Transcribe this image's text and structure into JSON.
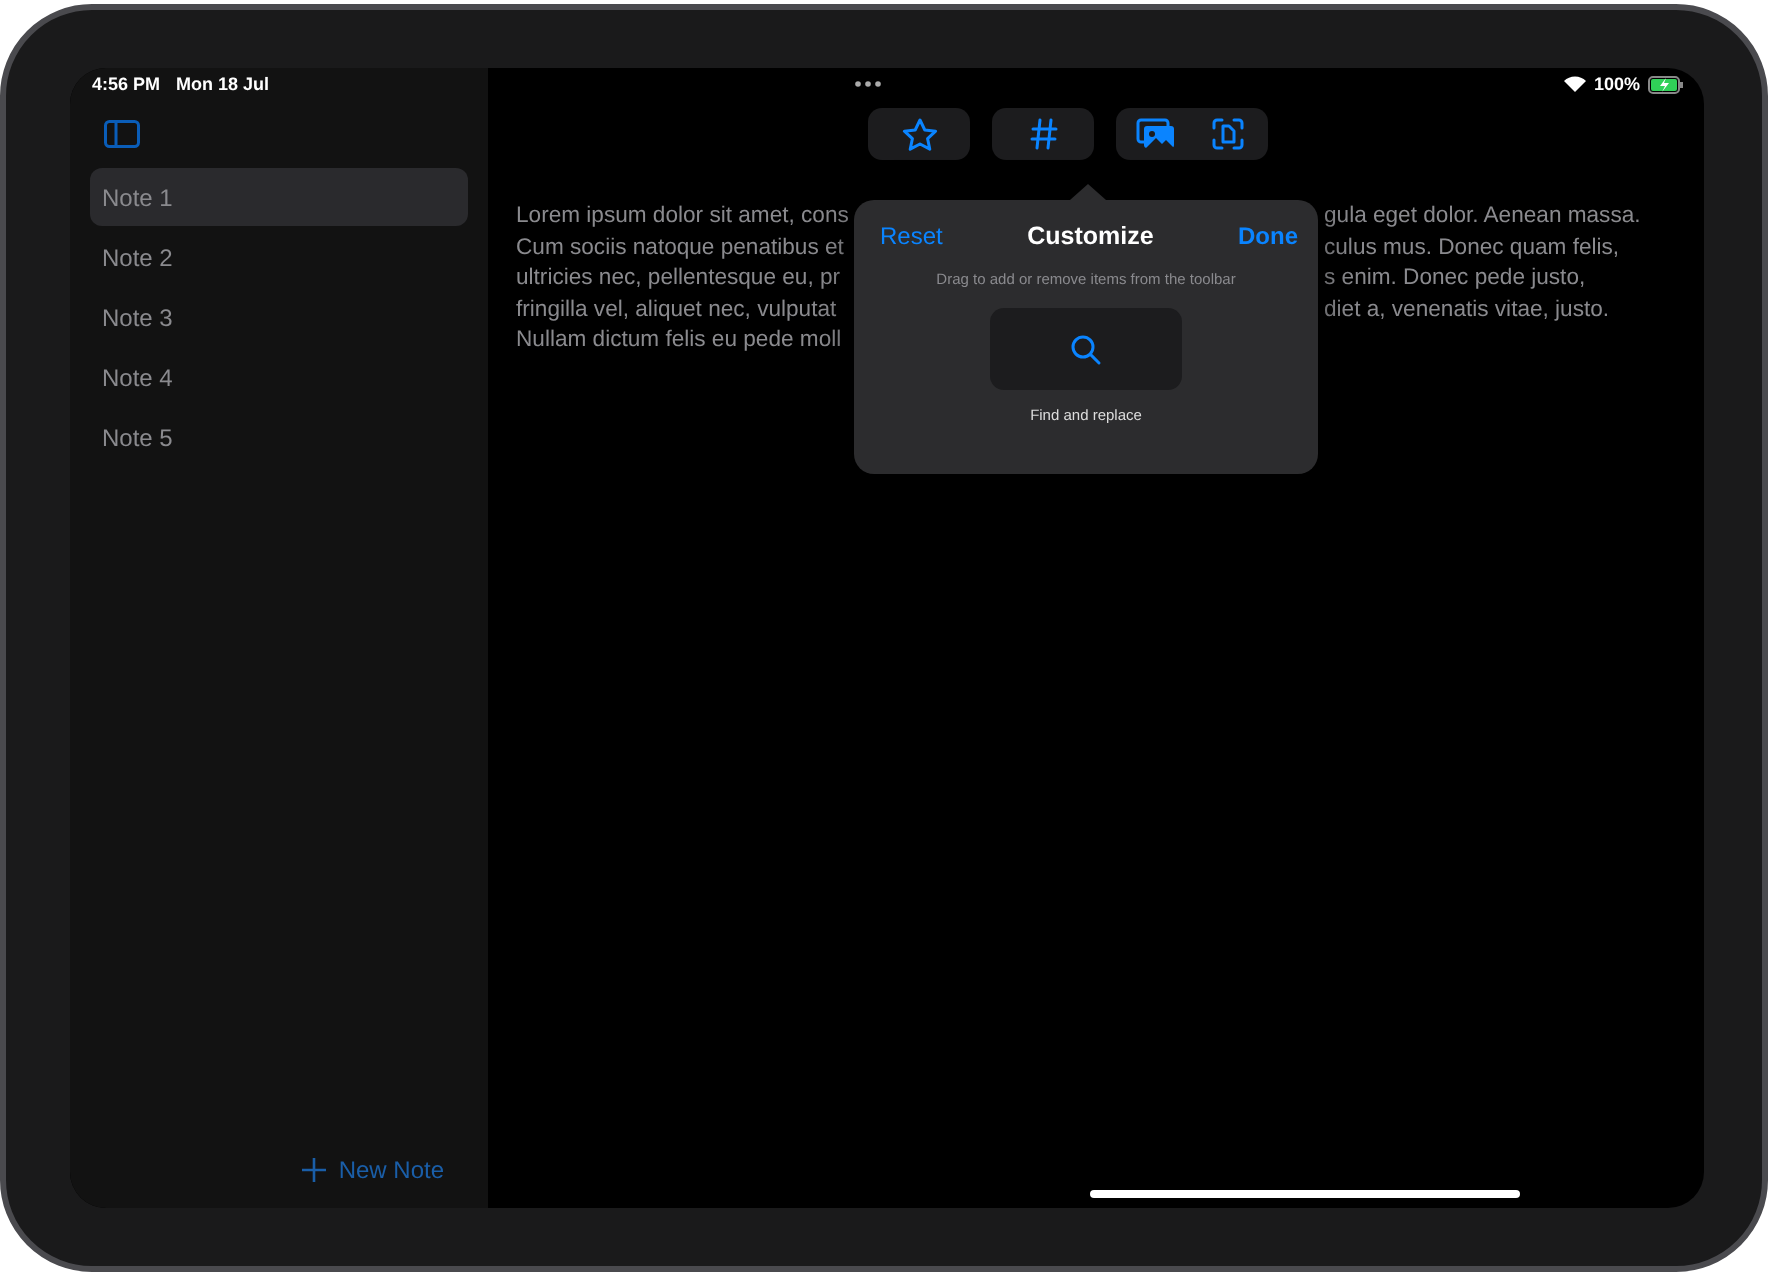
{
  "status_bar": {
    "time": "4:56 PM",
    "date": "Mon 18 Jul",
    "battery": "100%",
    "charging": true
  },
  "sidebar": {
    "notes": [
      {
        "label": "Note 1",
        "selected": true
      },
      {
        "label": "Note 2",
        "selected": false
      },
      {
        "label": "Note 3",
        "selected": false
      },
      {
        "label": "Note 4",
        "selected": false
      },
      {
        "label": "Note 5",
        "selected": false
      }
    ],
    "new_note_button": "New Note"
  },
  "toolbar": {
    "groups": [
      [
        {
          "kind": "star"
        }
      ],
      [
        {
          "kind": "number"
        }
      ],
      [
        {
          "kind": "photo"
        },
        {
          "kind": "scan"
        }
      ]
    ]
  },
  "editor": {
    "lines": [
      {
        "left": "Lorem ipsum dolor sit amet, cons",
        "right": "gula eget dolor. Aenean massa."
      },
      {
        "left": "Cum sociis natoque penatibus et",
        "right": "culus mus. Donec quam felis,"
      },
      {
        "left": "ultricies nec, pellentesque eu, pr",
        "right": "s enim. Donec pede justo,"
      },
      {
        "left": "fringilla vel, aliquet nec, vulputat",
        "right": "diet a, venenatis vitae, justo."
      },
      {
        "left": "Nullam dictum felis eu pede moll"
      }
    ]
  },
  "popover": {
    "reset": "Reset",
    "title": "Customize",
    "done": "Done",
    "hint": "Drag to add or remove items from the toolbar",
    "items": [
      {
        "kind": "search",
        "label": "Find and replace"
      }
    ]
  }
}
